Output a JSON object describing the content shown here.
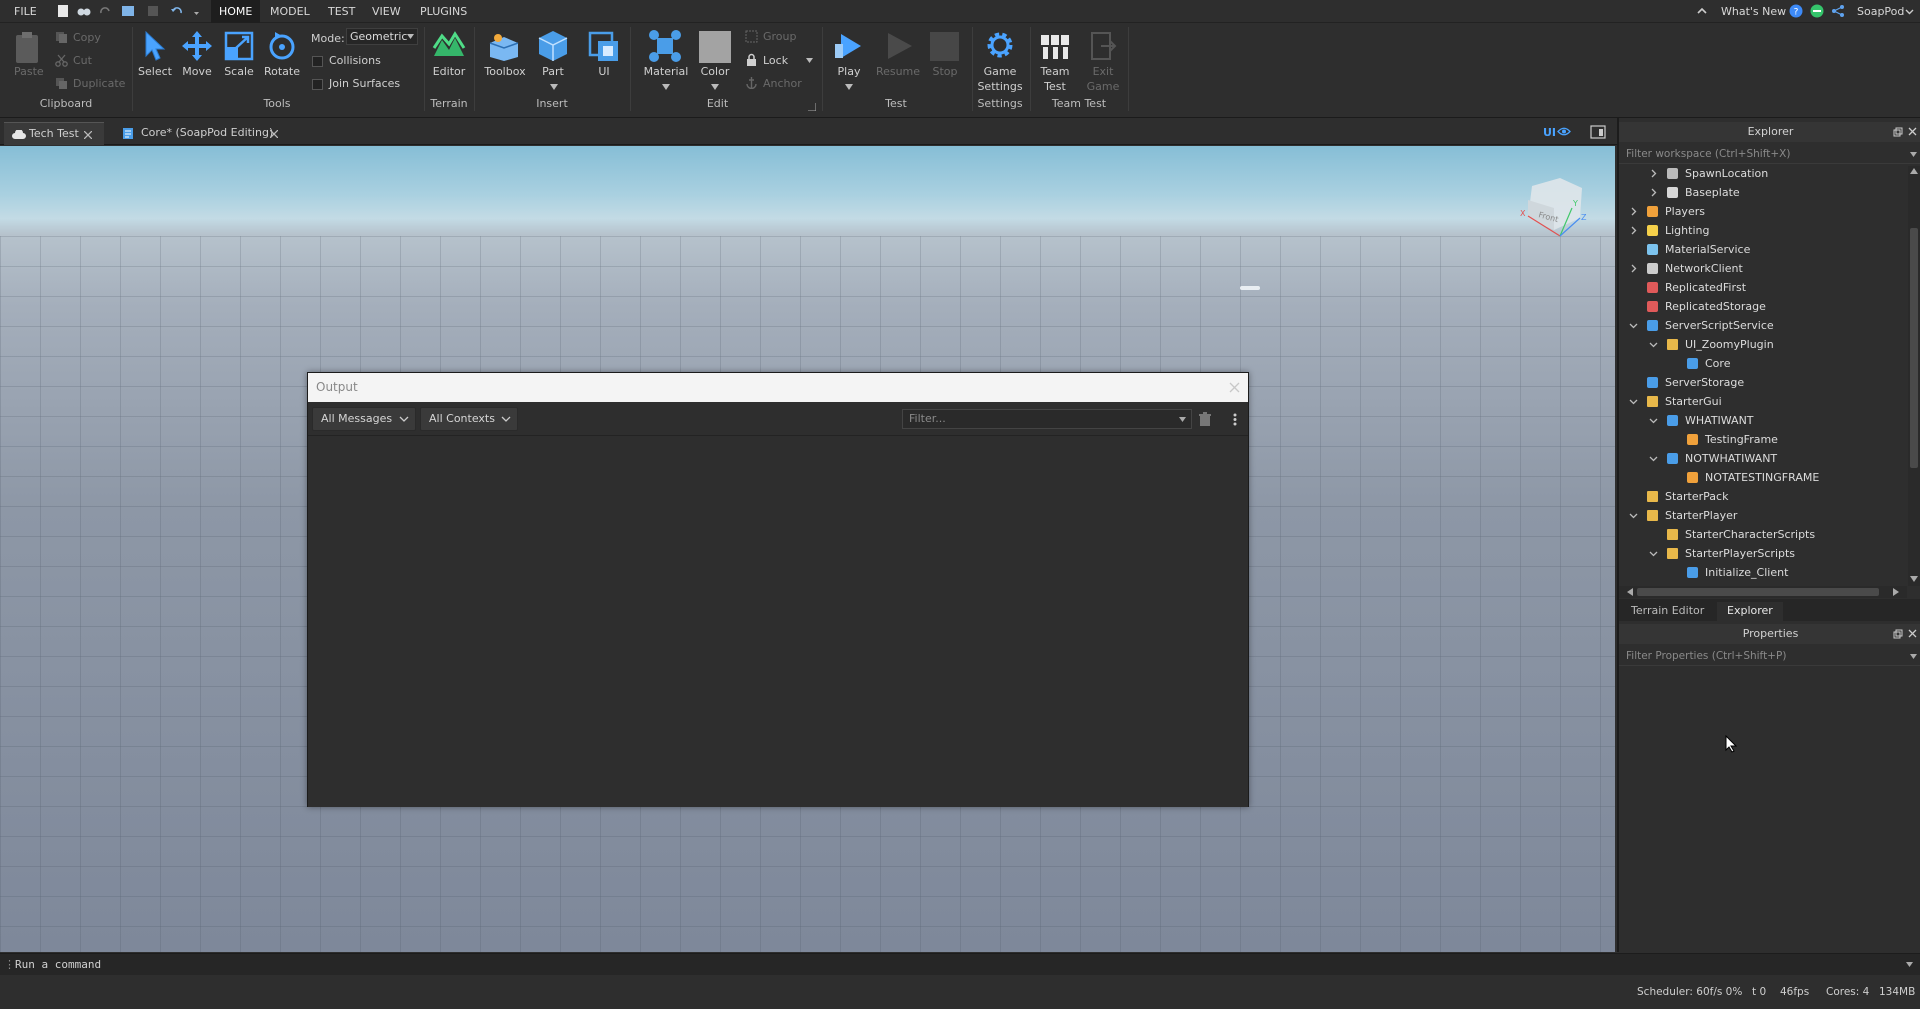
{
  "menubar": {
    "items": [
      "FILE",
      "HOME",
      "MODEL",
      "TEST",
      "VIEW",
      "PLUGINS"
    ],
    "active": "HOME",
    "whats_new": "What's New",
    "username": "SoapPod"
  },
  "ribbon": {
    "clipboard": {
      "title": "Clipboard",
      "paste": "Paste",
      "copy": "Copy",
      "cut": "Cut",
      "duplicate": "Duplicate"
    },
    "tools": {
      "title": "Tools",
      "select": "Select",
      "move": "Move",
      "scale": "Scale",
      "rotate": "Rotate",
      "mode_label": "Mode:",
      "mode_value": "Geometric",
      "collisions": "Collisions",
      "join_surfaces": "Join Surfaces"
    },
    "terrain": {
      "title": "Terrain",
      "editor": "Editor"
    },
    "insert": {
      "title": "Insert",
      "toolbox": "Toolbox",
      "part": "Part",
      "ui": "UI"
    },
    "edit": {
      "title": "Edit",
      "material": "Material",
      "color": "Color",
      "group": "Group",
      "lock": "Lock",
      "anchor": "Anchor"
    },
    "test": {
      "title": "Test",
      "play": "Play",
      "resume": "Resume",
      "stop": "Stop"
    },
    "settings": {
      "title": "Settings",
      "game_settings_1": "Game",
      "game_settings_2": "Settings"
    },
    "team_test": {
      "title": "Team Test",
      "team_test_1": "Team",
      "team_test_2": "Test",
      "exit_game_1": "Exit",
      "exit_game_2": "Game"
    }
  },
  "tabs": [
    {
      "label": "Tech Test"
    },
    {
      "label": "Core* (SoapPod Editing)"
    }
  ],
  "viewport": {
    "ui_toggle": "UI",
    "viewcube_face": "Front",
    "axis_x": "X",
    "axis_y": "Y",
    "axis_z": "Z"
  },
  "output": {
    "title": "Output",
    "messages_filter": "All Messages",
    "contexts_filter": "All Contexts",
    "filter_placeholder": "Filter..."
  },
  "explorer": {
    "title": "Explorer",
    "filter_placeholder": "Filter workspace (Ctrl+Shift+X)",
    "tree": [
      {
        "label": "SpawnLocation",
        "depth": 1,
        "expander": "collapsed",
        "icon": "spawn-icon"
      },
      {
        "label": "Baseplate",
        "depth": 1,
        "expander": "collapsed",
        "icon": "part-icon"
      },
      {
        "label": "Players",
        "depth": 0,
        "expander": "collapsed",
        "icon": "players-icon"
      },
      {
        "label": "Lighting",
        "depth": 0,
        "expander": "collapsed",
        "icon": "lighting-icon"
      },
      {
        "label": "MaterialService",
        "depth": 0,
        "expander": "none",
        "icon": "material-service-icon"
      },
      {
        "label": "NetworkClient",
        "depth": 0,
        "expander": "collapsed",
        "icon": "network-icon"
      },
      {
        "label": "ReplicatedFirst",
        "depth": 0,
        "expander": "none",
        "icon": "replicated-icon"
      },
      {
        "label": "ReplicatedStorage",
        "depth": 0,
        "expander": "none",
        "icon": "replicated-icon"
      },
      {
        "label": "ServerScriptService",
        "depth": 0,
        "expander": "expanded",
        "icon": "server-script-icon"
      },
      {
        "label": "UI_ZoomyPlugin",
        "depth": 1,
        "expander": "expanded",
        "icon": "folder-icon"
      },
      {
        "label": "Core",
        "depth": 2,
        "expander": "none",
        "icon": "script-icon"
      },
      {
        "label": "ServerStorage",
        "depth": 0,
        "expander": "none",
        "icon": "server-storage-icon"
      },
      {
        "label": "StarterGui",
        "depth": 0,
        "expander": "expanded",
        "icon": "starter-folder-icon"
      },
      {
        "label": "WHATIWANT",
        "depth": 1,
        "expander": "expanded",
        "icon": "screengui-icon"
      },
      {
        "label": "TestingFrame",
        "depth": 2,
        "expander": "none",
        "icon": "frame-icon"
      },
      {
        "label": "NOTWHATIWANT",
        "depth": 1,
        "expander": "expanded",
        "icon": "screengui-icon"
      },
      {
        "label": "NOTATESTINGFRAME",
        "depth": 2,
        "expander": "none",
        "icon": "frame-icon"
      },
      {
        "label": "StarterPack",
        "depth": 0,
        "expander": "none",
        "icon": "starter-folder-icon"
      },
      {
        "label": "StarterPlayer",
        "depth": 0,
        "expander": "expanded",
        "icon": "starter-folder-icon"
      },
      {
        "label": "StarterCharacterScripts",
        "depth": 1,
        "expander": "none",
        "icon": "starter-folder-icon"
      },
      {
        "label": "StarterPlayerScripts",
        "depth": 1,
        "expander": "expanded",
        "icon": "starter-folder-icon"
      },
      {
        "label": "Initialize_Client",
        "depth": 2,
        "expander": "none",
        "icon": "script-icon"
      }
    ],
    "bottom_tabs": [
      "Terrain Editor",
      "Explorer"
    ],
    "active_bottom_tab": "Explorer"
  },
  "properties": {
    "title": "Properties",
    "filter_placeholder": "Filter Properties (Ctrl+Shift+P)"
  },
  "command_bar": {
    "placeholder": "Run a command"
  },
  "status": {
    "scheduler": "Scheduler: 60f/s 0%",
    "t": "t 0",
    "fps": "46fps",
    "cores": "Cores: 4",
    "memory": "134MB"
  },
  "colors": {
    "accent": "#4aa3ff",
    "panel": "#2e2e2e",
    "titlebar": "#f4f4f4"
  }
}
